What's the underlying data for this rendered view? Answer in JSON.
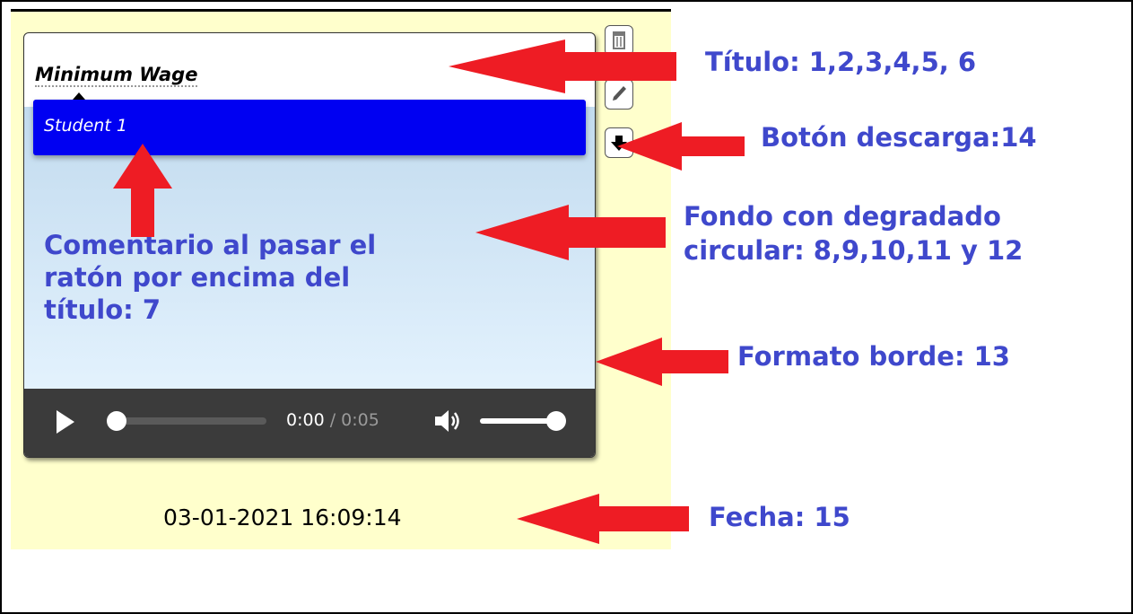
{
  "card": {
    "title": "Minimum Wage",
    "tooltip": "Student 1",
    "player": {
      "current_time": "0:00",
      "separator": " / ",
      "duration": "0:05",
      "progress": 0,
      "volume": 1
    }
  },
  "date": "03-01-2021 16:09:14",
  "annotations": {
    "title": "Título: 1,2,3,4,5, 6",
    "download": "Botón descarga:14",
    "background": "Fondo con degradado circular: 8,9,10,11 y 12",
    "border": "Formato borde: 13",
    "date": "Fecha: 15",
    "comment": "Comentario al pasar el ratón por encima del título: 7"
  },
  "colors": {
    "annotation_text": "#3f48cc",
    "arrow": "#ee1c24",
    "panel": "#ffffcc",
    "tooltip": "#0000f2",
    "player": "#3b3b3b"
  },
  "icons": [
    "trash-icon",
    "pencil-icon",
    "download-icon",
    "play-icon",
    "volume-icon"
  ]
}
